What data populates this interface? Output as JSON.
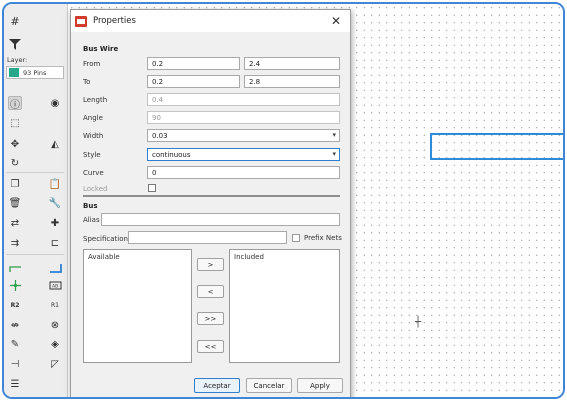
{
  "toolbar": {
    "layer_label": "Layer:",
    "layer_value": "93 Pins",
    "layer_color": "#27a88a"
  },
  "dialog": {
    "title": "Properties",
    "bus_wire": {
      "section_title": "Bus Wire",
      "from_label": "From",
      "from_x": "0.2",
      "from_y": "2.4",
      "to_label": "To",
      "to_x": "0.2",
      "to_y": "2.8",
      "length_label": "Length",
      "length_value": "0.4",
      "angle_label": "Angle",
      "angle_value": "90",
      "width_label": "Width",
      "width_value": "0.03",
      "style_label": "Style",
      "style_value": "continuous",
      "curve_label": "Curve",
      "curve_value": "0",
      "locked_label": "Locked"
    },
    "bus": {
      "section_title": "Bus",
      "alias_label": "Alias",
      "alias_value": "",
      "spec_label": "Specification",
      "spec_value": "",
      "prefix_nets_label": "Prefix Nets",
      "available_header": "Available",
      "included_header": "Included",
      "move_right": ">",
      "move_left": "<",
      "move_all_right": ">>",
      "move_all_left": "<<"
    },
    "buttons": {
      "accept": "Aceptar",
      "cancel": "Cancelar",
      "apply": "Apply"
    }
  },
  "colors": {
    "selection": "#2e8bd7",
    "frame": "#3f86d6"
  }
}
